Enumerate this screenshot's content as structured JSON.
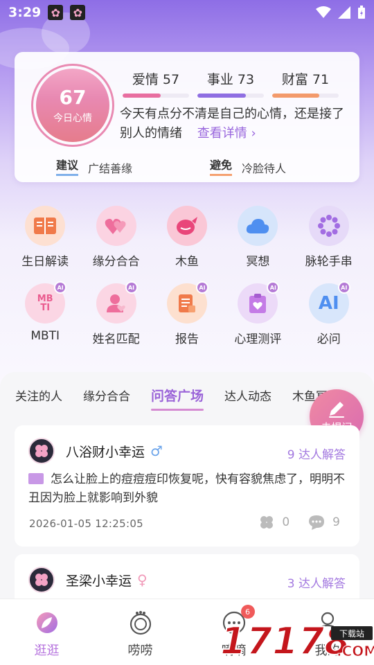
{
  "status_bar": {
    "time": "3:29"
  },
  "fortune": {
    "score": "67",
    "score_label": "今日心情",
    "stats": [
      {
        "label": "爱情",
        "value": "57",
        "fill": 0.57,
        "color": "#e86ea0"
      },
      {
        "label": "事业",
        "value": "73",
        "fill": 0.73,
        "color": "#8f6ee2"
      },
      {
        "label": "财富",
        "value": "71",
        "fill": 0.71,
        "color": "#f39a6b"
      }
    ],
    "description": "今天有点分不清是自己的心情，还是接了别人的情绪",
    "detail_link": "查看详情 ›",
    "suggest": {
      "key": "建议",
      "value": "广结善缘"
    },
    "avoid": {
      "key": "避免",
      "value": "冷脸待人"
    }
  },
  "features_row1": [
    {
      "label": "生日解读",
      "icon": "book-icon"
    },
    {
      "label": "缘分合合",
      "icon": "hearts-icon"
    },
    {
      "label": "木鱼",
      "icon": "wooden-fish-icon"
    },
    {
      "label": "冥想",
      "icon": "cloud-icon"
    },
    {
      "label": "脉轮手串",
      "icon": "bracelet-icon"
    }
  ],
  "features_row2": [
    {
      "label": "MBTI",
      "icon": "mbti-icon",
      "badge": "AI",
      "glyph": "MB TI"
    },
    {
      "label": "姓名匹配",
      "icon": "name-match-icon",
      "badge": "AI"
    },
    {
      "label": "报告",
      "icon": "report-icon",
      "badge": "AI"
    },
    {
      "label": "心理测评",
      "icon": "clipboard-heart-icon",
      "badge": "AI"
    },
    {
      "label": "必问",
      "icon": "ai-ask-icon",
      "badge": "AI",
      "glyph": "AI"
    }
  ],
  "tabs": [
    "关注的人",
    "缘分合合",
    "问答广场",
    "达人动态",
    "木鱼冥想"
  ],
  "active_tab": "问答广场",
  "fab_label": "去提问",
  "posts": [
    {
      "user": "八浴财小幸运",
      "gender": "♂",
      "answers": "9 达人解答",
      "question": "怎么让脸上的痘痘痘印恢复呢，快有容貌焦虑了，明明不丑因为脸上就影响到外貌",
      "time": "2026-01-05 12:25:05",
      "likes": "0",
      "comments": "9"
    },
    {
      "user": "圣梁小幸运",
      "gender": "♀",
      "answers": "3 达人解答"
    }
  ],
  "bottom_nav": [
    {
      "label": "逛逛",
      "icon": "compass-leaf-icon"
    },
    {
      "label": "唠唠",
      "icon": "chat-bubble-icon"
    },
    {
      "label": "嘀嘀",
      "icon": "message-icon",
      "badge": "6"
    },
    {
      "label": "我的",
      "icon": "profile-icon"
    }
  ],
  "watermark": {
    "number": "17178",
    "download": "下载站",
    "domain": ".COM"
  },
  "colors": {
    "accent": "#9a63d8",
    "pink": "#e86ea0",
    "purple_bg": "#8e6ee6"
  }
}
